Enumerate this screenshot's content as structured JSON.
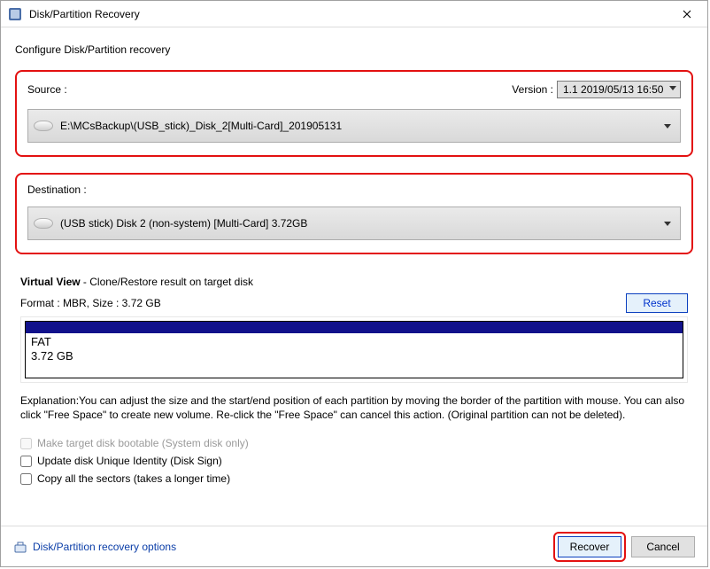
{
  "window": {
    "title": "Disk/Partition Recovery",
    "close_label": "Close"
  },
  "configure_label": "Configure Disk/Partition recovery",
  "source": {
    "label": "Source :",
    "version_label": "Version :",
    "version_value": "1.1  2019/05/13 16:50",
    "path": "E:\\MCsBackup\\(USB_stick)_Disk_2[Multi-Card]_201905131"
  },
  "destination": {
    "label": "Destination :",
    "value": "(USB stick) Disk 2 (non-system) [Multi-Card]   3.72GB"
  },
  "virtual_view": {
    "title_bold": "Virtual View",
    "title_rest": " - Clone/Restore result on target disk",
    "format_line": "Format : MBR,  Size : 3.72 GB",
    "reset_label": "Reset",
    "partition": {
      "fs": "FAT",
      "size": "3.72 GB"
    },
    "explanation": "Explanation:You can adjust the size and the start/end position of each partition by moving the border of the partition with mouse. You can also click \"Free Space\" to create new volume. Re-click the \"Free Space\" can cancel this action. (Original partition can not be deleted)."
  },
  "checks": {
    "bootable": "Make target disk bootable (System disk only)",
    "update_uid": "Update disk Unique Identity (Disk Sign)",
    "copy_all": "Copy all the sectors (takes a longer time)"
  },
  "footer": {
    "options_link": "Disk/Partition recovery options",
    "recover_label": "Recover",
    "cancel_label": "Cancel"
  }
}
